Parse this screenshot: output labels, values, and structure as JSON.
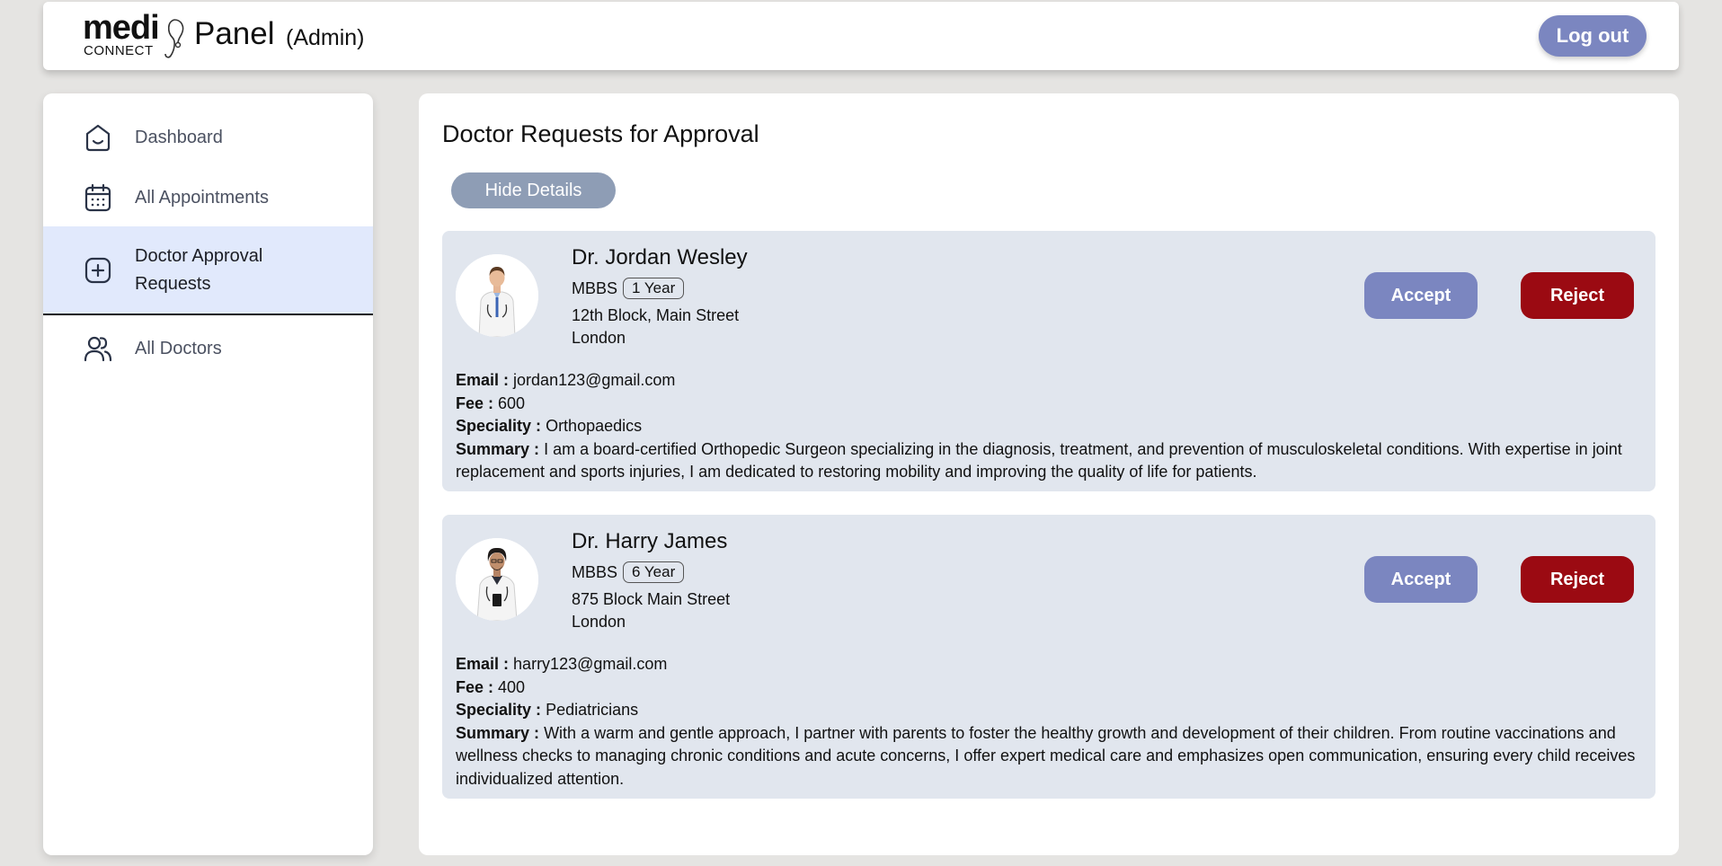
{
  "header": {
    "logo_main": "medi",
    "logo_sub": "CONNECT",
    "title": "Panel",
    "subtitle": "(Admin)",
    "logout_label": "Log out"
  },
  "sidebar": {
    "items": [
      {
        "label": "Dashboard",
        "icon": "home-icon"
      },
      {
        "label": "All Appointments",
        "icon": "calendar-icon"
      },
      {
        "label": "Doctor Approval Requests",
        "icon": "plus-square-icon",
        "active": true
      },
      {
        "label": "All Doctors",
        "icon": "users-icon"
      }
    ]
  },
  "main": {
    "title": "Doctor Requests for Approval",
    "hide_details_label": "Hide Details",
    "requests": [
      {
        "name": "Dr. Jordan Wesley",
        "degree": "MBBS",
        "experience": "1 Year",
        "address_line1": "12th Block, Main Street",
        "address_line2": "London",
        "accept_label": "Accept",
        "reject_label": "Reject",
        "email_label": "Email :",
        "email": "jordan123@gmail.com",
        "fee_label": "Fee :",
        "fee": "600",
        "speciality_label": "Speciality :",
        "speciality": "Orthopaedics",
        "summary_label": "Summary :",
        "summary": "I am a board-certified Orthopedic Surgeon specializing in the diagnosis, treatment, and prevention of musculoskeletal conditions. With expertise in joint replacement and sports injuries, I am dedicated to restoring mobility and improving the quality of life for patients."
      },
      {
        "name": "Dr. Harry James",
        "degree": "MBBS",
        "experience": "6 Year",
        "address_line1": "875 Block Main Street",
        "address_line2": "London",
        "accept_label": "Accept",
        "reject_label": "Reject",
        "email_label": "Email :",
        "email": "harry123@gmail.com",
        "fee_label": "Fee :",
        "fee": "400",
        "speciality_label": "Speciality :",
        "speciality": "Pediatricians",
        "summary_label": "Summary :",
        "summary": "With a warm and gentle approach, I partner with parents to foster the healthy growth and development of their children. From routine vaccinations and wellness checks to managing chronic conditions and acute concerns, I offer expert medical care and emphasizes open communication, ensuring every child receives individualized attention."
      }
    ]
  },
  "colors": {
    "accent": "#7b86c0",
    "reject": "#9b0a12",
    "active_nav": "#e1e9fc",
    "card_bg": "#e1e6ee",
    "hide_button": "#8e9db5"
  }
}
